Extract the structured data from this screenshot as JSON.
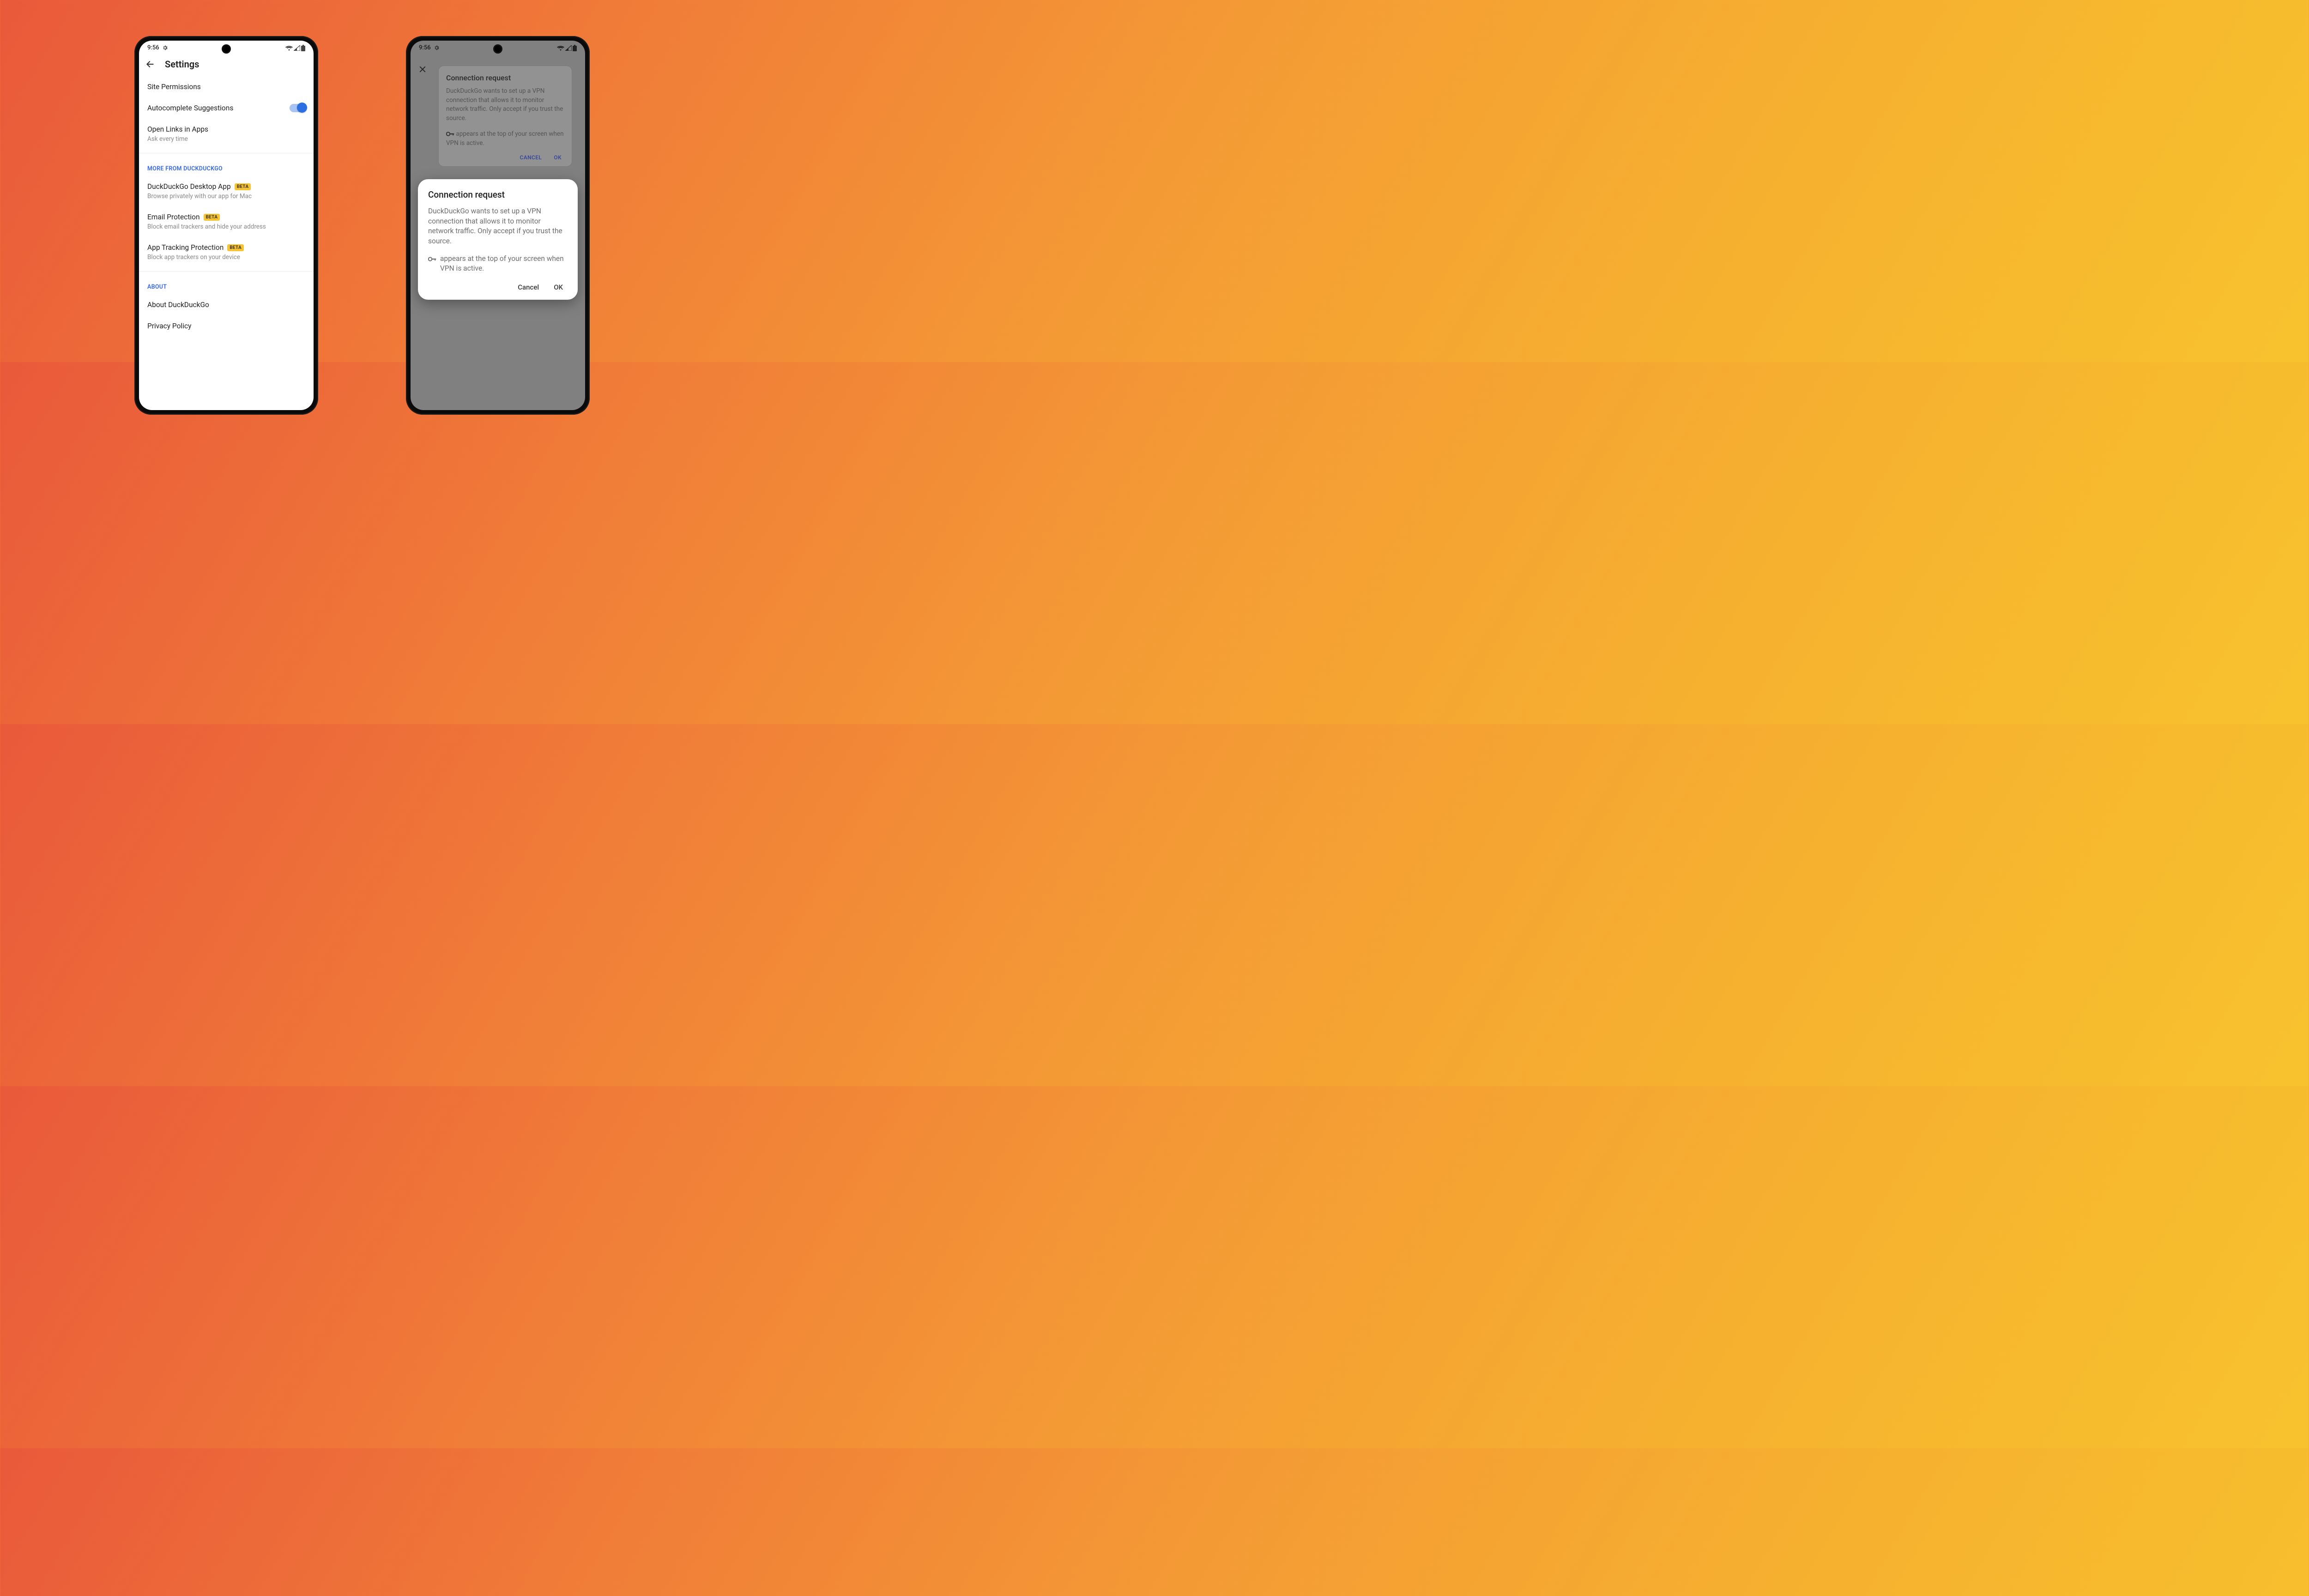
{
  "statusbar": {
    "time": "9:56"
  },
  "phone1": {
    "title": "Settings",
    "rows": {
      "site_permissions": "Site Permissions",
      "autocomplete": "Autocomplete Suggestions",
      "open_links": {
        "label": "Open Links in Apps",
        "sub": "Ask every time"
      }
    },
    "section_more": "MORE FROM DUCKDUCKGO",
    "more": {
      "desktop": {
        "label": "DuckDuckGo Desktop App",
        "badge": "BETA",
        "sub": "Browse privately with our app for Mac"
      },
      "email": {
        "label": "Email Protection",
        "badge": "BETA",
        "sub": "Block email trackers and hide your address"
      },
      "atp": {
        "label": "App Tracking Protection",
        "badge": "BETA",
        "sub": "Block app trackers on your device"
      }
    },
    "section_about": "ABOUT",
    "about": {
      "about_ddg": "About DuckDuckGo",
      "privacy": "Privacy Policy"
    }
  },
  "phone2": {
    "behind": {
      "title": "Connection request",
      "body1": "DuckDuckGo wants to set up a VPN connection that allows it to monitor network traffic. Only accept if you trust the source.",
      "body2": "appears at the top of your screen when VPN is active.",
      "cancel": "CANCEL",
      "ok": "OK"
    },
    "dialog": {
      "title": "Connection request",
      "body1": "DuckDuckGo wants to set up a VPN connection that allows it to monitor network traffic. Only accept if you trust the source.",
      "body2": "appears at the top of your screen when VPN is active.",
      "cancel": "Cancel",
      "ok": "OK"
    }
  }
}
